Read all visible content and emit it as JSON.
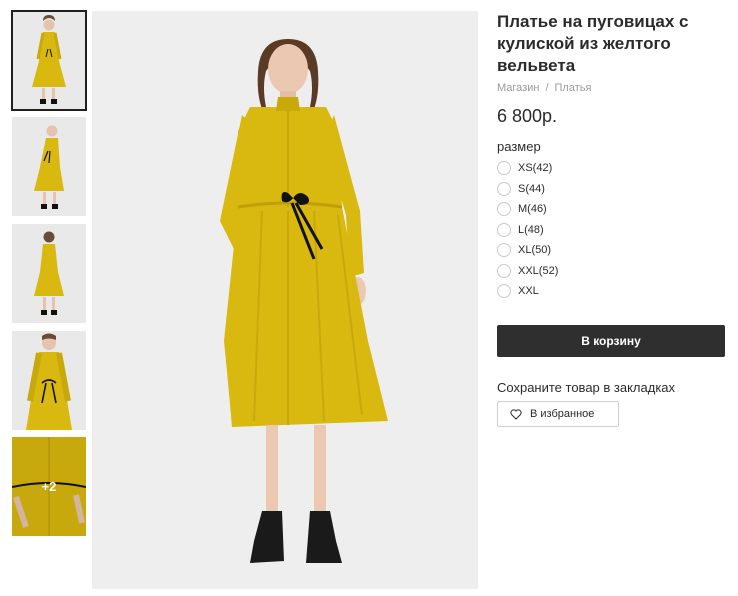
{
  "product": {
    "title": "Платье на пуговицах с кулиской из желтого вельвета",
    "price": "6 800р."
  },
  "breadcrumbs": [
    "Магазин",
    "Платья"
  ],
  "breadcrumb_separator": "/",
  "size": {
    "label": "размер",
    "options": [
      "XS(42)",
      "S(44)",
      "M(46)",
      "L(48)",
      "XL(50)",
      "XXL(52)",
      "XXL"
    ]
  },
  "actions": {
    "cart_label": "В корзину",
    "bookmark_prompt": "Сохраните товар в закладках",
    "favorite_label": "В избранное",
    "favorite_icon": "heart-icon"
  },
  "gallery": {
    "thumbnails": [
      "full-front",
      "side-view",
      "back-view",
      "upper-body",
      "close-up"
    ],
    "more_badge": "+2"
  },
  "colors": {
    "dress": "#d9b80f",
    "cart_button": "#2f2f2f",
    "photo_background": "#eeeeef"
  }
}
